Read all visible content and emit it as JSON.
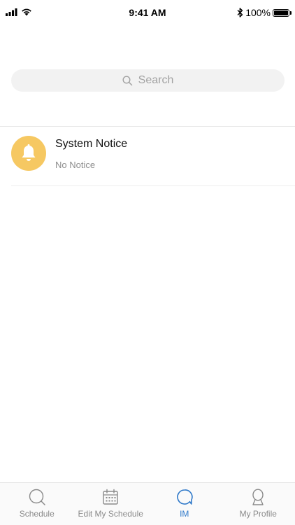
{
  "status_bar": {
    "time": "9:41 AM",
    "battery": "100%",
    "battery_level": 1.0
  },
  "search": {
    "label": "Search",
    "icon": "search-icon"
  },
  "notices": [
    {
      "title": "System Notice",
      "subtitle": "No Notice",
      "icon": "bell-icon",
      "icon_bg": "#f6c862"
    }
  ],
  "tabs": [
    {
      "label": "Schedule",
      "icon": "search-circle-icon",
      "active": false
    },
    {
      "label": "Edit My Schedule",
      "icon": "calendar-icon",
      "active": false
    },
    {
      "label": "IM",
      "icon": "chat-bubble-icon",
      "active": true
    },
    {
      "label": "My Profile",
      "icon": "person-icon",
      "active": false
    }
  ],
  "colors": {
    "accent": "#2f79c9",
    "inactive": "#8a8a8a"
  }
}
